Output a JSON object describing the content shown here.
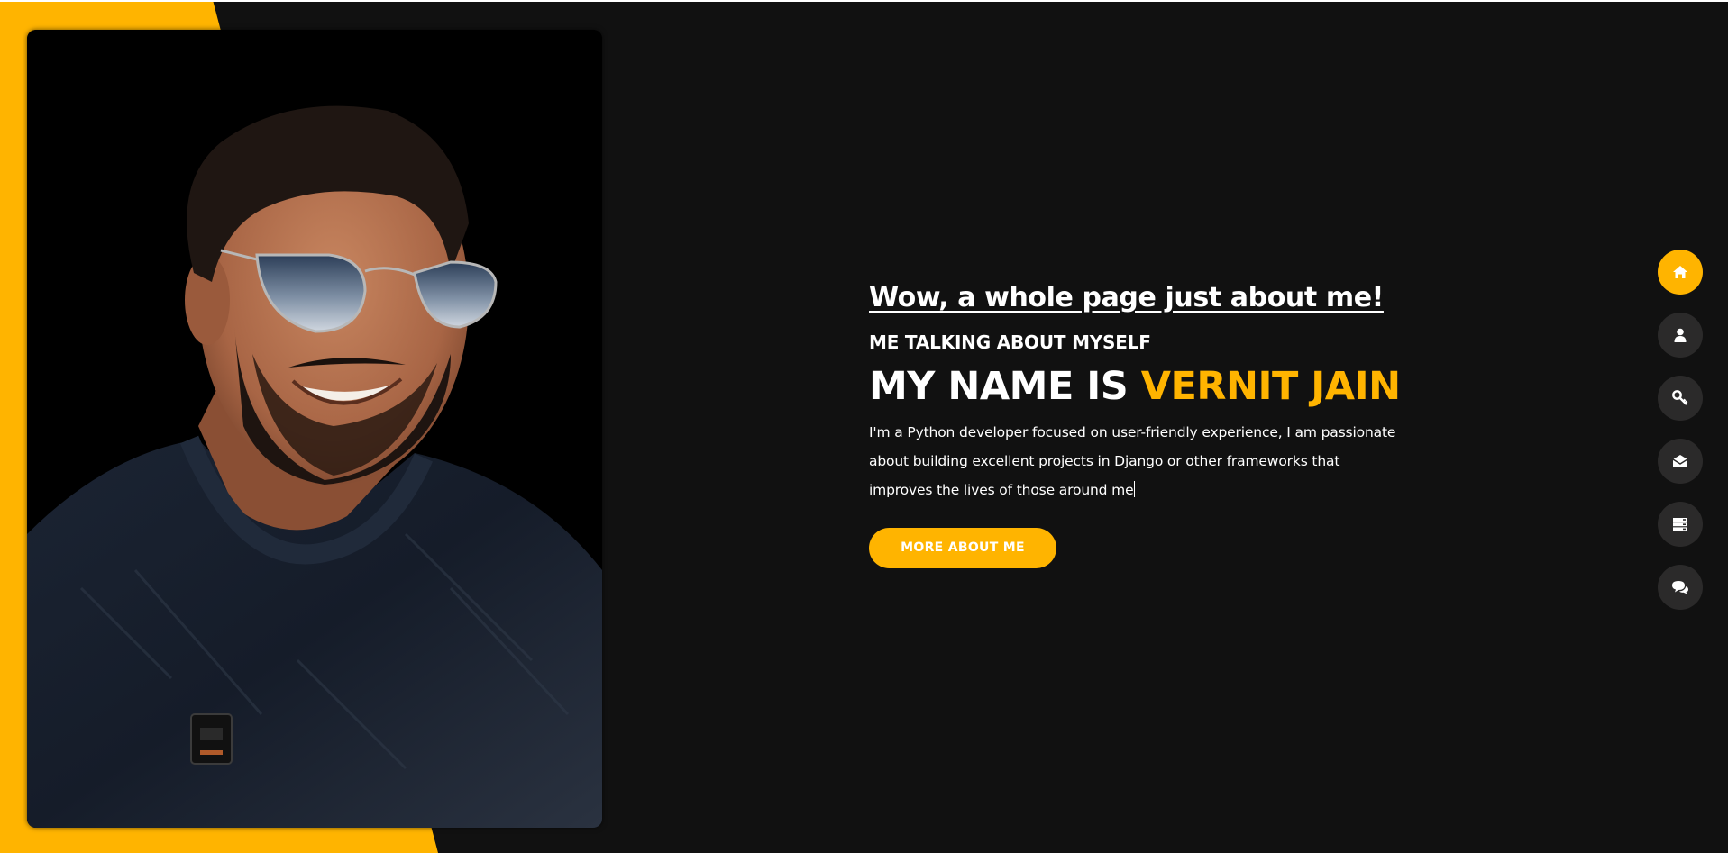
{
  "hero": {
    "tagline": "Wow, a whole page just about me!",
    "subtitle": "ME TALKING ABOUT MYSELF",
    "name_prefix": "MY NAME IS ",
    "name_highlight": "VERNIT JAIN",
    "bio": "I'm a Python developer focused on user-friendly experience, I am passionate about building excellent projects in Django or other frameworks that improves the lives of those around me",
    "button_label": "MORE ABOUT ME"
  },
  "nav": {
    "items": [
      {
        "icon": "home-icon",
        "active": true
      },
      {
        "icon": "user-icon",
        "active": false
      },
      {
        "icon": "key-icon",
        "active": false
      },
      {
        "icon": "envelope-open-icon",
        "active": false
      },
      {
        "icon": "server-icon",
        "active": false
      },
      {
        "icon": "comments-icon",
        "active": false
      }
    ]
  },
  "colors": {
    "accent": "#ffb400",
    "background": "#111111",
    "nav_bg": "#2b2a2a",
    "text": "#ffffff"
  }
}
